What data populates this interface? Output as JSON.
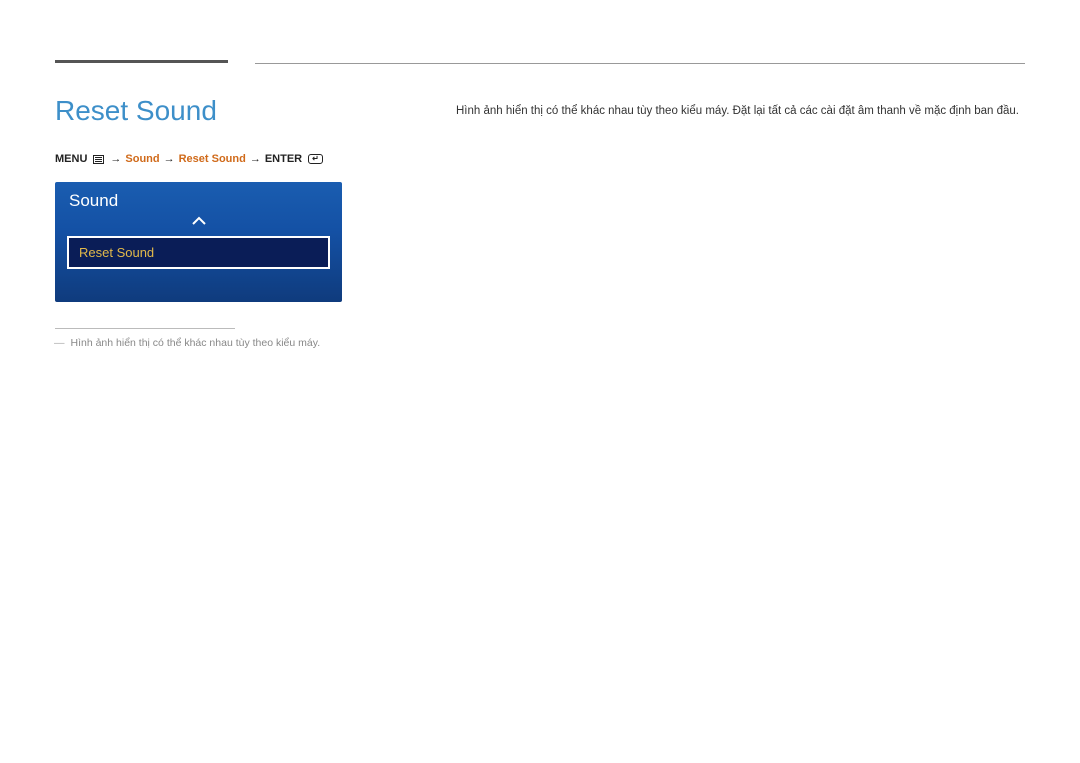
{
  "title": "Reset Sound",
  "breadcrumb": {
    "menu_label": "MENU",
    "arrow": "→",
    "path1": "Sound",
    "path2": "Reset Sound",
    "enter_label": "ENTER"
  },
  "menu": {
    "panel_title": "Sound",
    "selected_item": "Reset Sound"
  },
  "footnote": {
    "dash": "―",
    "text": "Hình ảnh hiển thị có thể khác nhau tùy theo kiểu máy."
  },
  "description": "Hình ảnh hiển thị có thể khác nhau tùy theo kiểu máy. Đặt lại tất cả các cài đặt âm thanh về mặc định ban đầu."
}
